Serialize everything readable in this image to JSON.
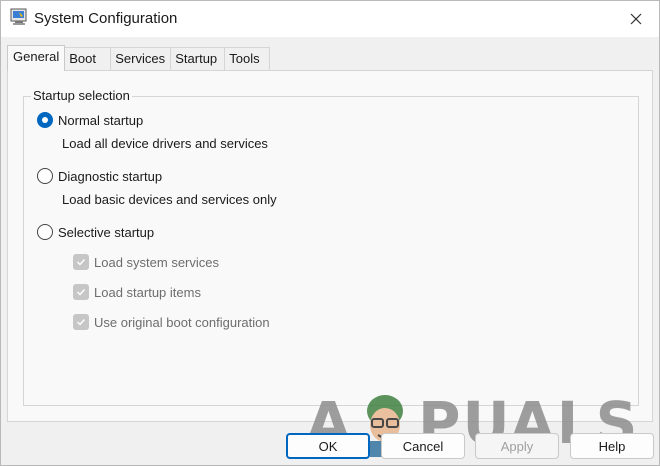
{
  "window": {
    "title": "System Configuration"
  },
  "tabs": [
    {
      "label": "General",
      "active": true
    },
    {
      "label": "Boot",
      "active": false
    },
    {
      "label": "Services",
      "active": false
    },
    {
      "label": "Startup",
      "active": false
    },
    {
      "label": "Tools",
      "active": false
    }
  ],
  "startup_selection": {
    "legend": "Startup selection",
    "options": [
      {
        "label": "Normal startup",
        "description": "Load all device drivers and services",
        "checked": true
      },
      {
        "label": "Diagnostic startup",
        "description": "Load basic devices and services only",
        "checked": false
      },
      {
        "label": "Selective startup",
        "checked": false
      }
    ],
    "selective_items": [
      {
        "label": "Load system services",
        "checked": true,
        "disabled": true
      },
      {
        "label": "Load startup items",
        "checked": true,
        "disabled": true
      },
      {
        "label": "Use original boot configuration",
        "checked": true,
        "disabled": true
      }
    ]
  },
  "buttons": {
    "ok": "OK",
    "cancel": "Cancel",
    "apply": "Apply",
    "help": "Help"
  },
  "watermark": {
    "text": "A PUALS"
  },
  "colors": {
    "accent": "#0067c0",
    "panel": "#f9f9f9",
    "frame": "#f0f0f0"
  }
}
